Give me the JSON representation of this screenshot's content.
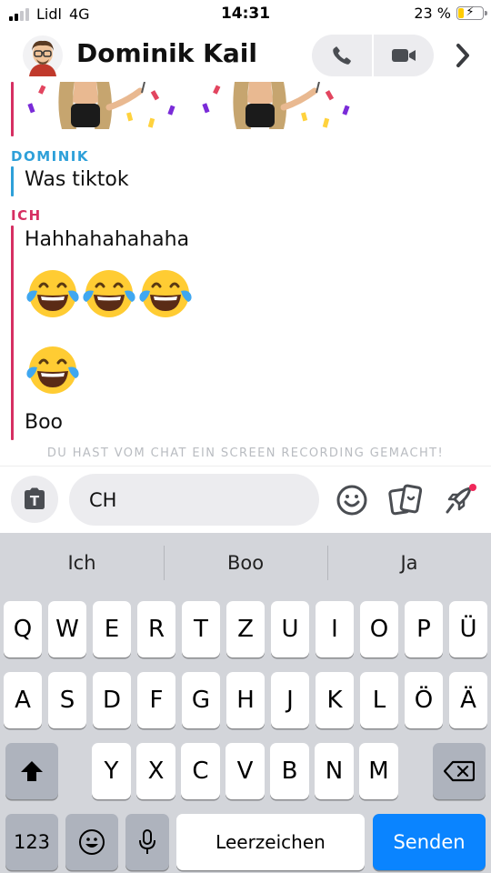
{
  "status_bar": {
    "carrier": "Lidl",
    "network": "4G",
    "time": "14:31",
    "battery_percent_label": "23 %",
    "battery_level": 0.23,
    "charging": true,
    "signal_bars_active": 2,
    "signal_bars_total": 4
  },
  "header": {
    "contact_name": "Dominik Kail",
    "avatar_icon": "bitmoji-avatar-icon",
    "call_icon": "phone-icon",
    "video_icon": "video-camera-icon",
    "more_icon": "chevron-right-icon"
  },
  "chat": {
    "messages": [
      {
        "sender": "DOMINIK",
        "sender_color": "#2ea0d9",
        "text": "Was tiktok"
      },
      {
        "sender": "ICH",
        "sender_color": "#d62f62",
        "text": "Hahhahahahaha"
      },
      {
        "sender": "ICH",
        "emoji": "😂😂😂"
      },
      {
        "sender": "ICH",
        "emoji": "😂"
      },
      {
        "sender": "ICH",
        "text": "Boo"
      }
    ],
    "notice": "DU HAST VOM CHAT EIN SCREEN RECORDING GEMACHT!"
  },
  "input": {
    "value": "CH",
    "camera_icon": "text-camera-icon",
    "tools": [
      "smiley-icon",
      "sticker-cards-icon",
      "rocket-icon"
    ]
  },
  "keyboard": {
    "suggestions": [
      "Ich",
      "Boo",
      "Ja"
    ],
    "row1": [
      "Q",
      "W",
      "E",
      "R",
      "T",
      "Z",
      "U",
      "I",
      "O",
      "P",
      "Ü"
    ],
    "row2": [
      "A",
      "S",
      "D",
      "F",
      "G",
      "H",
      "J",
      "K",
      "L",
      "Ö",
      "Ä"
    ],
    "row3": [
      "Y",
      "X",
      "C",
      "V",
      "B",
      "N",
      "M"
    ],
    "numbers_label": "123",
    "space_label": "Leerzeichen",
    "send_label": "Senden",
    "send_color": "#0a84ff"
  },
  "colors": {
    "dominik": "#2ea0d9",
    "ich": "#d62f62",
    "notice": "#b9bcc1"
  }
}
